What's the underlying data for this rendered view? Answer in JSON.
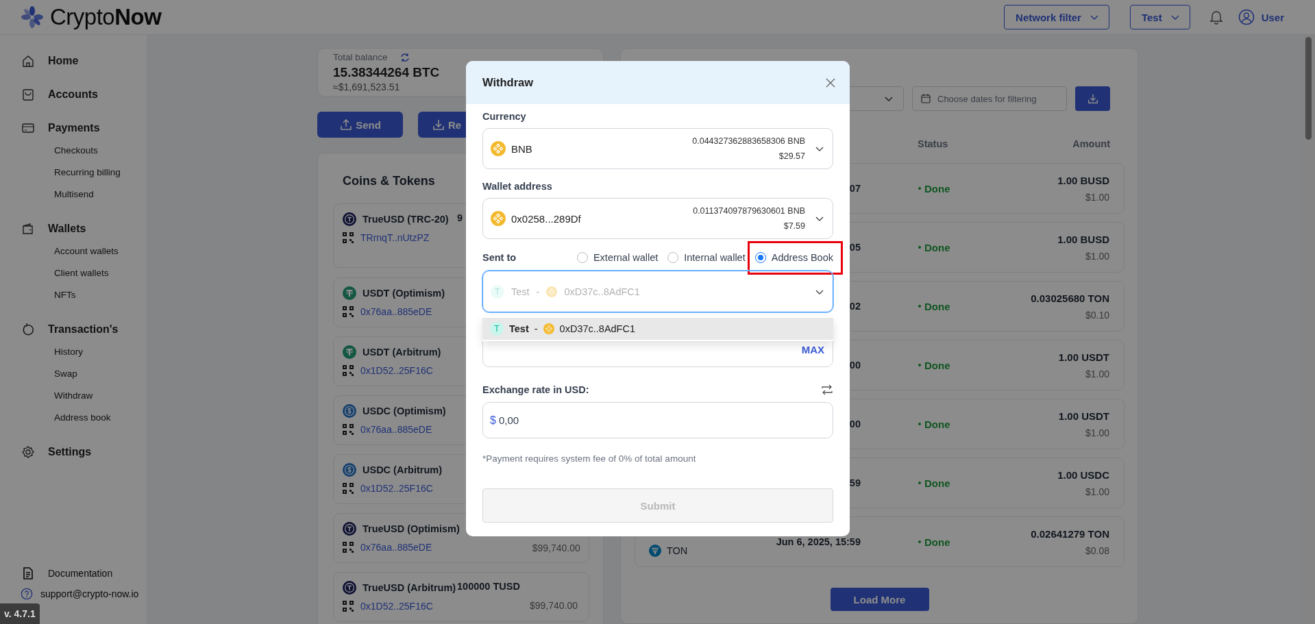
{
  "brand": "Crypto**Now**",
  "topbar": {
    "network_filter": "Network filter",
    "account": "Test",
    "user": "User"
  },
  "sidebar": {
    "items": [
      {
        "label": "Home"
      },
      {
        "label": "Accounts"
      },
      {
        "label": "Payments",
        "children": [
          {
            "label": "Checkouts"
          },
          {
            "label": "Recurring billing"
          },
          {
            "label": "Multisend"
          }
        ]
      },
      {
        "label": "Wallets",
        "children": [
          {
            "label": "Account wallets"
          },
          {
            "label": "Client wallets"
          },
          {
            "label": "NFTs"
          }
        ]
      },
      {
        "label": "Transaction's",
        "children": [
          {
            "label": "History"
          },
          {
            "label": "Swap"
          },
          {
            "label": "Withdraw"
          },
          {
            "label": "Address book"
          }
        ]
      },
      {
        "label": "Settings"
      }
    ],
    "footer": [
      {
        "label": "Documentation"
      },
      {
        "label": "support@crypto-now.io"
      }
    ]
  },
  "version": "v. 4.7.1",
  "balance": {
    "label": "Total balance",
    "amount": "15.38344264 BTC",
    "usd": "≈$1,691,523.51"
  },
  "actions": [
    "Send",
    "Re"
  ],
  "coins": {
    "title": "Coins & Tokens",
    "items": [
      {
        "kind": "tusd",
        "name": "TrueUSD (TRC-20)",
        "address": "TRrnqT..nUtzPZ",
        "amount": "9"
      },
      {
        "kind": "usdt",
        "name": "USDT (Optimism)",
        "address": "0x76aa..885eDE"
      },
      {
        "kind": "usdt",
        "name": "USDT (Arbitrum)",
        "address": "0x1D52..25F16C"
      },
      {
        "kind": "usdc",
        "name": "USDC (Optimism)",
        "address": "0x76aa..885eDE"
      },
      {
        "kind": "usdc",
        "name": "USDC (Arbitrum)",
        "address": "0x1D52..25F16C"
      },
      {
        "kind": "tusd",
        "name": "TrueUSD (Optimism)",
        "address": "0x76aa..885eDE",
        "usd": "$99,740.00"
      },
      {
        "kind": "tusd",
        "name": "TrueUSD (Arbitrum)",
        "address": "0x1D52..25F16C",
        "amount": "100000 TUSD",
        "usd": "$99,740.00"
      }
    ]
  },
  "transactions": {
    "date_placeholder": "Choose dates for filtering",
    "columns": [
      "Status",
      "Amount"
    ],
    "rows": [
      {
        "date": "07",
        "status": "Done",
        "amount": "1.00 BUSD",
        "usd": "$1.00"
      },
      {
        "date": "05",
        "status": "Done",
        "amount": "1.00 BUSD",
        "usd": "$1.00"
      },
      {
        "date": "02",
        "status": "Done",
        "amount": "0.03025680 TON",
        "usd": "$0.10"
      },
      {
        "date": "00",
        "status": "Done",
        "amount": "1.00 USDT",
        "usd": "$1.00"
      },
      {
        "date": "00",
        "status": "Done",
        "amount": "1.00 USDT",
        "usd": "$1.00"
      },
      {
        "date": "59",
        "status": "Done",
        "amount": "1.00 USDC",
        "usd": "$1.00"
      },
      {
        "kind": "ton",
        "coin": "TON",
        "date": "Jun 6, 2025, 15:59",
        "status": "Done",
        "amount": "0.02641279 TON",
        "usd": "$0.08"
      }
    ],
    "load_more": "Load More"
  },
  "modal": {
    "title": "Withdraw",
    "currency": {
      "label": "Currency",
      "value": "BNB",
      "balance": "0.044327362883658306 BNB",
      "usd": "$29.57"
    },
    "wallet": {
      "label": "Wallet address",
      "value": "0x0258...289Df",
      "balance": "0.011374097879630601 BNB",
      "usd": "$7.59"
    },
    "sent_to": {
      "label": "Sent to",
      "options": [
        {
          "label": "External wallet",
          "selected": false,
          "highlighted": false
        },
        {
          "label": "Internal wallet",
          "selected": false,
          "highlighted": false
        },
        {
          "label": "Address Book",
          "selected": true,
          "highlighted": true
        }
      ]
    },
    "recipient": {
      "initial": "T",
      "name": "Test",
      "separator": "-",
      "address": "0xD37c..8AdFC1",
      "focused": true
    },
    "recipient_options": [
      {
        "initial": "T",
        "name": "Test",
        "separator": "-",
        "address": "0xD37c..8AdFC1",
        "hovered": true
      }
    ],
    "amount": {
      "max": "MAX"
    },
    "exchange": {
      "label": "Exchange rate in USD:",
      "symbol": "$",
      "value": "0,00"
    },
    "fee_note": "*Payment requires system fee of 0% of total amount",
    "submit": {
      "label": "Submit",
      "disabled": true
    }
  }
}
